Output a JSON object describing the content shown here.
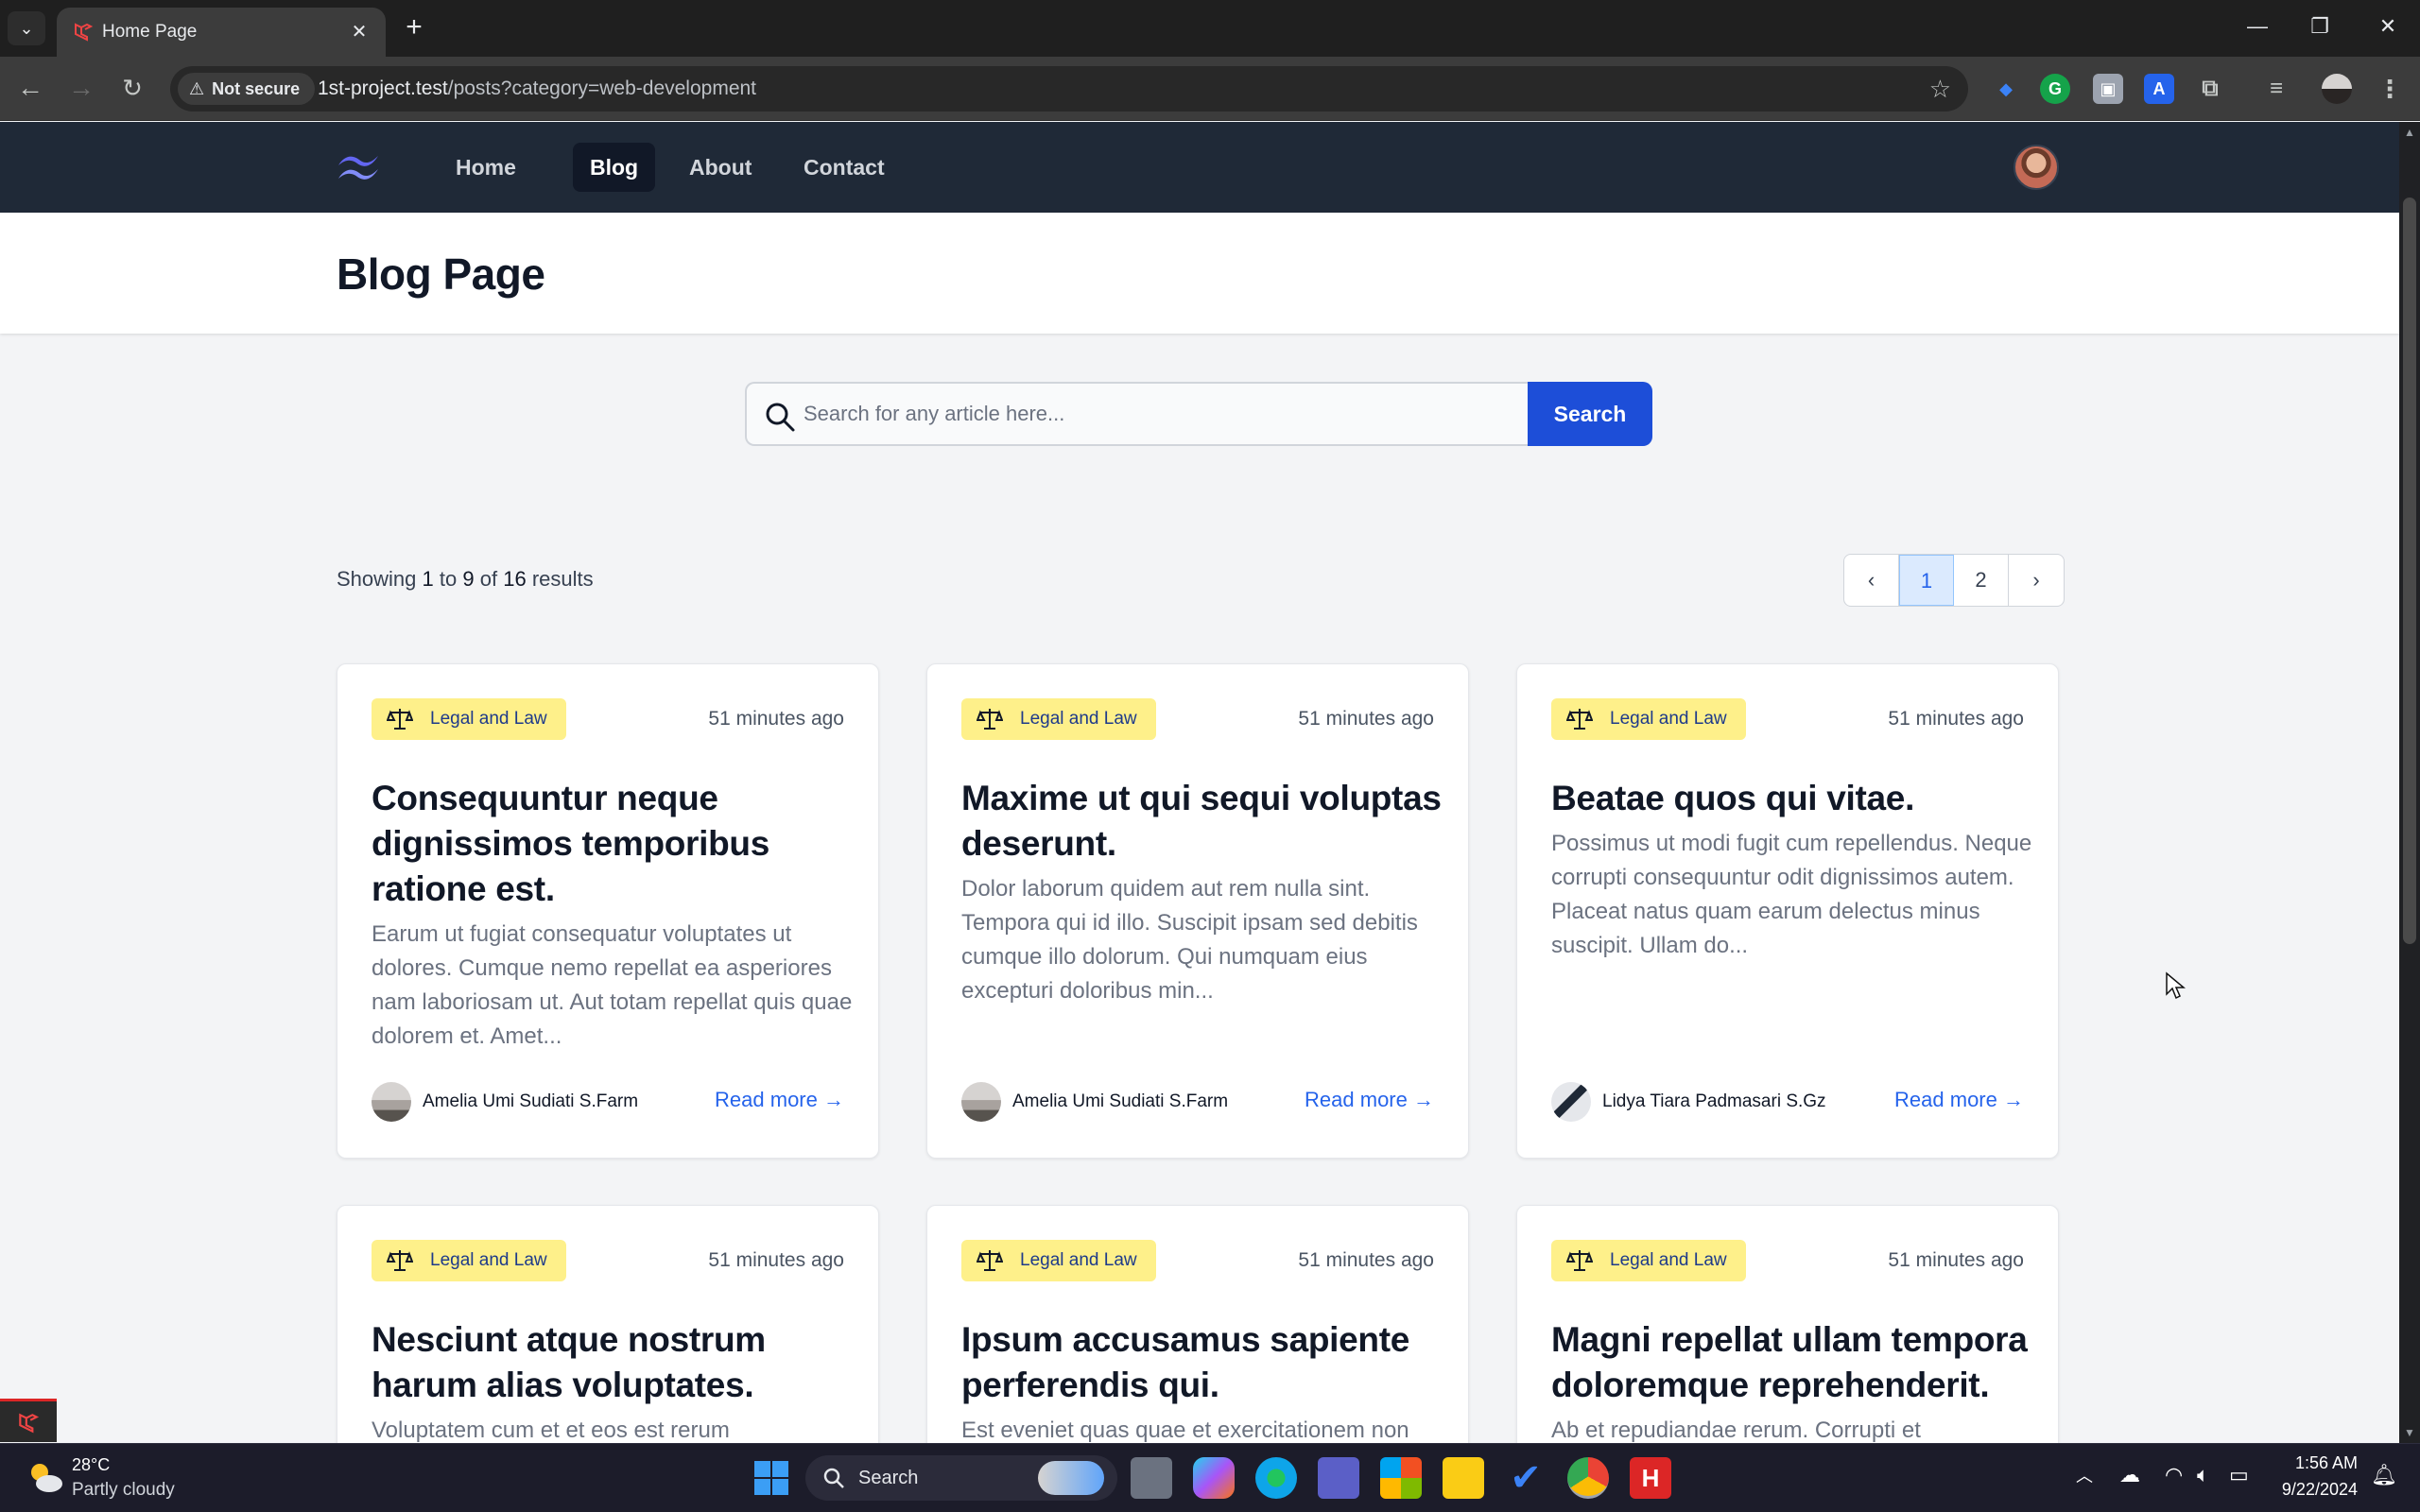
{
  "browser": {
    "tab_title": "Home Page",
    "security_label": "Not secure",
    "url_host": "1st-project.test",
    "url_path": "/posts?category=web-development"
  },
  "nav": {
    "links": [
      "Home",
      "Blog",
      "About",
      "Contact"
    ],
    "active": "Blog"
  },
  "page": {
    "title": "Blog Page"
  },
  "search": {
    "placeholder": "Search for any article here...",
    "button": "Search"
  },
  "results": {
    "from": "1",
    "to": "9",
    "total": "16",
    "showing": "Showing",
    "to_word": "to",
    "of_word": "of",
    "results_word": "results"
  },
  "pagination": {
    "prev": "‹",
    "pages": [
      "1",
      "2"
    ],
    "current": "1",
    "next": "›"
  },
  "posts": [
    {
      "category": "Legal and Law",
      "time": "51 minutes ago",
      "title": "Consequuntur neque dignissimos temporibus ratione est.",
      "excerpt": "Earum ut fugiat consequatur voluptates ut dolores. Cumque nemo repellat ea asperiores nam laboriosam ut. Aut totam repellat quis quae dolorem et. Amet...",
      "author": "Amelia Umi Sudiati S.Farm",
      "read_more": "Read more"
    },
    {
      "category": "Legal and Law",
      "time": "51 minutes ago",
      "title": "Maxime ut qui sequi voluptas deserunt.",
      "excerpt": "Dolor laborum quidem aut rem nulla sint. Tempora qui id illo. Suscipit ipsam sed debitis cumque illo dolorum. Qui numquam eius excepturi doloribus min...",
      "author": "Amelia Umi Sudiati S.Farm",
      "read_more": "Read more"
    },
    {
      "category": "Legal and Law",
      "time": "51 minutes ago",
      "title": "Beatae quos qui vitae.",
      "excerpt": "Possimus ut modi fugit cum repellendus. Neque corrupti consequuntur odit dignissimos autem. Placeat natus quam earum delectus minus suscipit. Ullam do...",
      "author": "Lidya Tiara Padmasari S.Gz",
      "read_more": "Read more"
    },
    {
      "category": "Legal and Law",
      "time": "51 minutes ago",
      "title": "Nesciunt atque nostrum harum alias voluptates.",
      "excerpt": "Voluptatem cum et et eos est rerum",
      "author": "",
      "read_more": ""
    },
    {
      "category": "Legal and Law",
      "time": "51 minutes ago",
      "title": "Ipsum accusamus sapiente perferendis qui.",
      "excerpt": "Est eveniet quas quae et exercitationem non",
      "author": "",
      "read_more": ""
    },
    {
      "category": "Legal and Law",
      "time": "51 minutes ago",
      "title": "Magni repellat ullam tempora doloremque reprehenderit.",
      "excerpt": "Ab et repudiandae rerum. Corrupti et",
      "author": "",
      "read_more": ""
    }
  ],
  "taskbar": {
    "temp": "28°C",
    "weather": "Partly cloudy",
    "search": "Search",
    "time": "1:56 AM",
    "date": "9/22/2024"
  },
  "colors": {
    "navbar": "#1f2937",
    "badge": "#fef08a",
    "primary": "#1d4ed8",
    "link": "#2563eb"
  },
  "icons": {
    "badge": "scale-balance-icon",
    "search": "search-icon",
    "read_more": "arrow-right-icon",
    "logo": "tailwind-logo-icon"
  }
}
